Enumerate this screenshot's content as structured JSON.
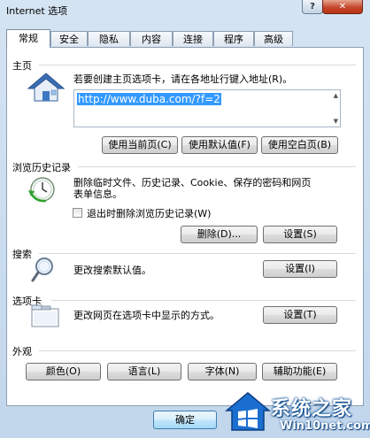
{
  "window": {
    "title": "Internet 选项"
  },
  "titlebar": {
    "help_label": "?",
    "close_label": "✕"
  },
  "tabs": [
    {
      "label": "常规",
      "active": true
    },
    {
      "label": "安全"
    },
    {
      "label": "隐私"
    },
    {
      "label": "内容"
    },
    {
      "label": "连接"
    },
    {
      "label": "程序"
    },
    {
      "label": "高级"
    }
  ],
  "home": {
    "section_label": "主页",
    "description": "若要创建主页选项卡，请在各地址行键入地址(R)。",
    "url": "http://www.duba.com/?f=2",
    "btn_current": "使用当前页(C)",
    "btn_default": "使用默认值(F)",
    "btn_blank": "使用空白页(B)"
  },
  "history": {
    "section_label": "浏览历史记录",
    "description_line1": "删除临时文件、历史记录、Cookie、保存的密码和网页",
    "description_line2": "表单信息。",
    "checkbox_label": "退出时删除浏览历史记录(W)",
    "btn_delete": "删除(D)...",
    "btn_settings": "设置(S)"
  },
  "search": {
    "section_label": "搜索",
    "description": "更改搜索默认值。",
    "btn_settings": "设置(I)"
  },
  "tabs_section": {
    "section_label": "选项卡",
    "description": "更改网页在选项卡中显示的方式。",
    "btn_settings": "设置(T)"
  },
  "appearance": {
    "section_label": "外观",
    "btn_colors": "颜色(O)",
    "btn_languages": "语言(L)",
    "btn_fonts": "字体(N)",
    "btn_accessibility": "辅助功能(E)"
  },
  "footer": {
    "ok_label": "确定"
  },
  "watermark": {
    "title": "系统之家",
    "subtitle": "Win10net.com"
  }
}
